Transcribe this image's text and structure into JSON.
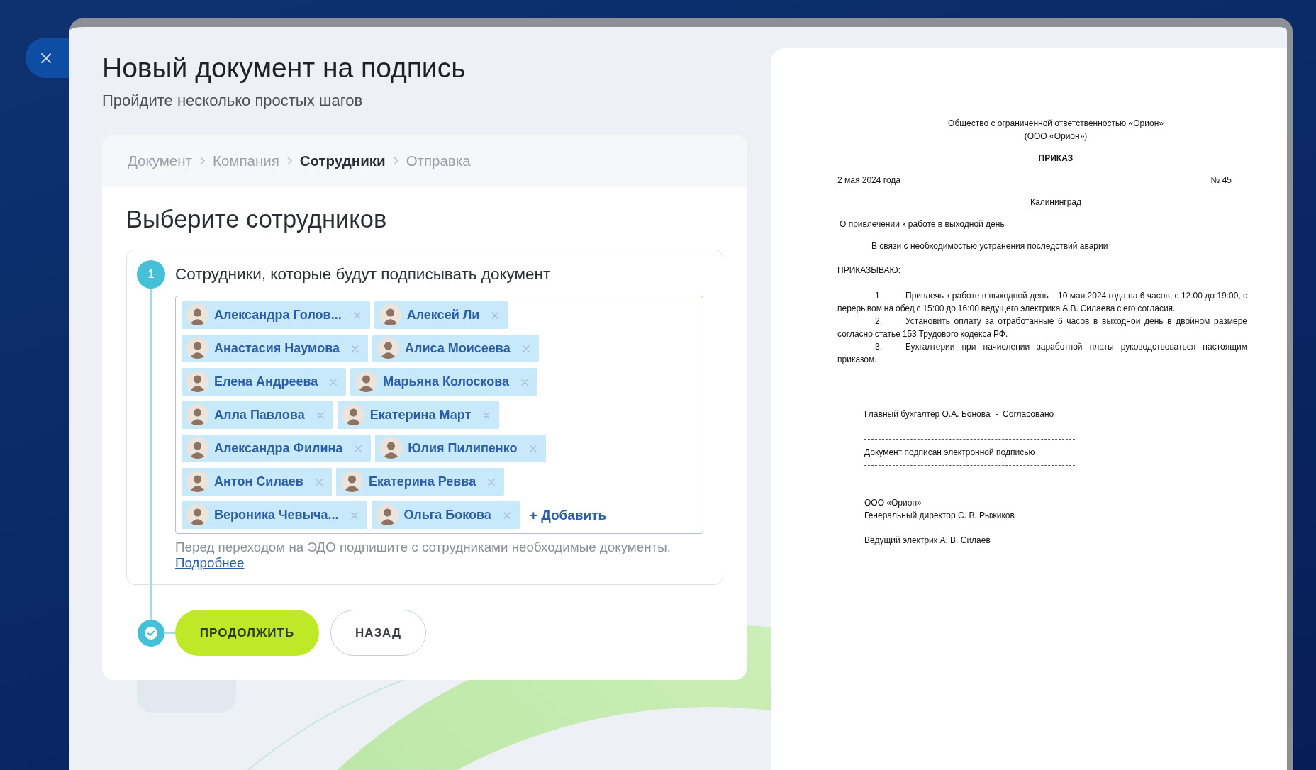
{
  "header": {
    "title": "Новый документ на подпись",
    "subtitle": "Пройдите несколько простых шагов"
  },
  "wizard": {
    "steps": [
      {
        "label": "Документ",
        "selected": false
      },
      {
        "label": "Компания",
        "selected": false
      },
      {
        "label": "Сотрудники",
        "selected": true
      },
      {
        "label": "Отправка",
        "selected": false
      }
    ],
    "heading": "Выберите сотрудников",
    "signers": {
      "step_number": "1",
      "label": "Сотрудники, которые будут подписывать документ",
      "chips": [
        {
          "name": "Александра Голов..."
        },
        {
          "name": "Алексей Ли"
        },
        {
          "name": "Анастасия Наумова"
        },
        {
          "name": "Алиса Моисеева"
        },
        {
          "name": "Елена Андреева"
        },
        {
          "name": "Марьяна Колоскова"
        },
        {
          "name": "Алла Павлова"
        },
        {
          "name": "Екатерина Март"
        },
        {
          "name": "Александра Филина"
        },
        {
          "name": "Юлия Пилипенко"
        },
        {
          "name": "Антон Силаев"
        },
        {
          "name": "Екатерина Ревва"
        },
        {
          "name": "Вероника Чевыча..."
        },
        {
          "name": "Ольга Бокова"
        }
      ],
      "add_link": "+ Добавить",
      "hint": "Перед переходом на ЭДО подпишите с сотрудниками необходимые документы.",
      "hint_link": "Подробнее"
    },
    "buttons": [
      {
        "label": "ПРОДОЛЖИТЬ",
        "kind": "primary"
      },
      {
        "label": "НАЗАД",
        "kind": "secondary"
      }
    ]
  },
  "document": {
    "org_lines": [
      "Общество с ограниченной ответственностью «Орион»",
      "(ООО «Орион»)"
    ],
    "title": "ПРИКАЗ",
    "date": "2 мая 2024 года",
    "number": "№ 45",
    "city": "Калининград",
    "subject": "О привлечении к работе в выходной день",
    "preamble": "В связи с необходимостью устранения последствий аварии",
    "order_word": "ПРИКАЗЫВАЮ:",
    "items": [
      {
        "number": "1.",
        "text": "Привлечь к работе в выходной день – 10 мая 2024 года на 6 часов, с 12:00 до 19:00, с перерывом на обед с 15:00 до 16:00 ведущего электрика А.В. Силаева с его согласия."
      },
      {
        "number": "2.",
        "text": "Установить оплату за отработанные 6 часов в выходной день в двойном размере согласно статье 153 Трудового кодекса РФ."
      },
      {
        "number": "3.",
        "text": "Бухгалтерии при начислении заработной платы руководствоваться настоящим приказом."
      }
    ],
    "approval": "Главный бухгалтер О.А. Бонова  -  Согласовано",
    "signature_note": "Документ подписан электронной подписью",
    "signatories": [
      "ООО «Орион»",
      "Генеральный директор С. В. Рыжиков"
    ],
    "executor": "Ведущий электрик А. В. Силаев"
  }
}
